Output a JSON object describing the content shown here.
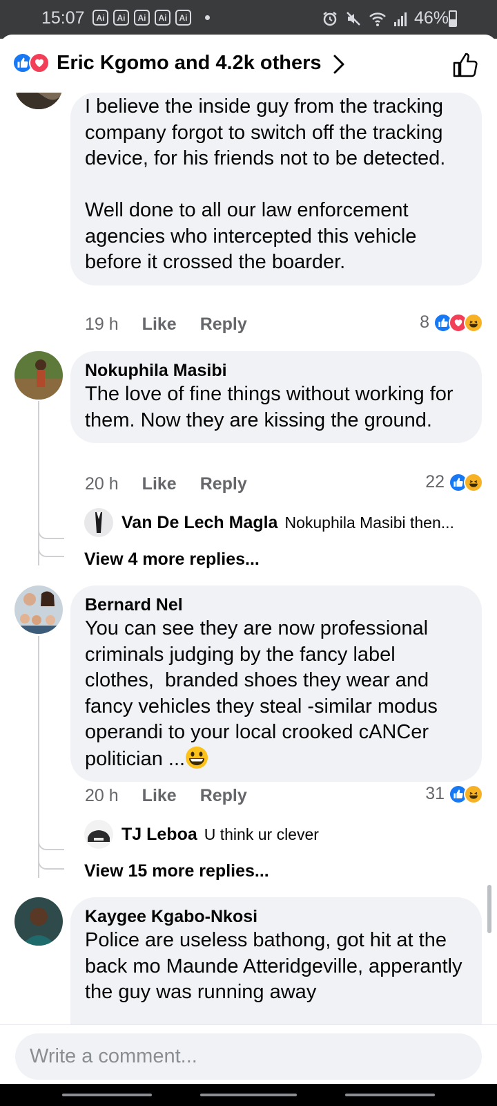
{
  "status_bar": {
    "time": "15:07",
    "app_badges": [
      "Ai",
      "Ai",
      "Ai",
      "Ai",
      "Ai"
    ],
    "battery": "46%",
    "battery_level": 0.46
  },
  "header": {
    "title": "Eric Kgomo and 4.2k others",
    "reactions": [
      "like-icon",
      "love-icon"
    ]
  },
  "comments": [
    {
      "author": "",
      "body": "I believe the inside guy from the tracking company forgot to switch off the tracking device, for his friends not to be detected.\n\nWell done to all our law enforcement agencies who intercepted this vehicle before it crossed the boarder.",
      "time": "19 h",
      "like_label": "Like",
      "reply_label": "Reply",
      "reaction_count": "8",
      "reactions": [
        "like-icon",
        "love-icon",
        "haha-icon"
      ]
    },
    {
      "author": "Nokuphila Masibi",
      "body": "The love of fine things without working for them. Now they are kissing the ground.",
      "time": "20 h",
      "like_label": "Like",
      "reply_label": "Reply",
      "reaction_count": "22",
      "reactions": [
        "like-icon",
        "haha-icon"
      ],
      "reply": {
        "author": "Van De Lech Magla",
        "text": "Nokuphila Masibi then..."
      },
      "more_replies": "View 4 more replies..."
    },
    {
      "author": "Bernard Nel",
      "body": "You can see they are now professional criminals judging by the fancy label clothes,  branded shoes they wear and fancy vehicles they steal -similar modus operandi to your local crooked cANCer politician ...",
      "emoji": "grinning-face-icon",
      "time": "20 h",
      "like_label": "Like",
      "reply_label": "Reply",
      "reaction_count": "31",
      "reactions": [
        "like-icon",
        "haha-icon"
      ],
      "reply": {
        "author": "TJ Leboa",
        "text": "U think ur clever"
      },
      "more_replies": "View 15 more replies..."
    },
    {
      "author": "Kaygee Kgabo-Nkosi",
      "body": "Police are useless bathong, got hit at the back mo Maunde Atteridgeville, apperantly the guy was running away"
    }
  ],
  "composer": {
    "placeholder": "Write a comment..."
  },
  "colors": {
    "like": "#1877f2",
    "love": "#f33e58",
    "haha": "#f7b125",
    "bubble": "#f0f2f5",
    "meta_text": "#65676b"
  }
}
